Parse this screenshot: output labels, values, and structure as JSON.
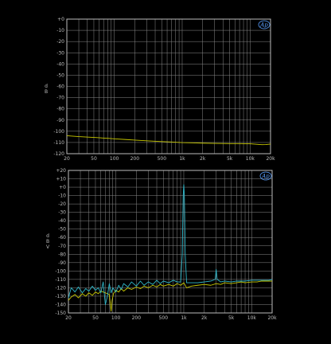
{
  "colors": {
    "background": "#000000",
    "plot_background": "#000000",
    "grid": "#8a8a8a",
    "frame": "#bdbdbd",
    "tick_text": "#bfbfbf",
    "logo": "#5aa0ff"
  },
  "logo_text": "Ap",
  "chart_data": [
    {
      "type": "line",
      "x_scale": "log",
      "xlim": [
        20,
        20000
      ],
      "ylim": [
        -120,
        0
      ],
      "grid": true,
      "y_unit_label": [
        "d",
        "B"
      ],
      "y_ticks": [
        0,
        -10,
        -20,
        -30,
        -40,
        -50,
        -60,
        -70,
        -80,
        -90,
        -100,
        -110,
        -120
      ],
      "y_tick_labels": [
        "+0",
        "-10",
        "-20",
        "-30",
        "-40",
        "-50",
        "-60",
        "-70",
        "-80",
        "-90",
        "-100",
        "-110",
        "-120"
      ],
      "x_ticks": [
        20,
        50,
        100,
        200,
        500,
        1000,
        2000,
        5000,
        10000,
        20000
      ],
      "x_tick_labels": [
        "20",
        "50",
        "100",
        "200",
        "500",
        "1k",
        "2k",
        "5k",
        "10k",
        "20k"
      ],
      "series": [
        {
          "color": "#c8c800",
          "x": [
            20,
            30,
            50,
            80,
            100,
            150,
            200,
            300,
            500,
            700,
            1000,
            1500,
            2000,
            3000,
            5000,
            7000,
            10000,
            13000,
            15000,
            17000,
            20000
          ],
          "y": [
            -104,
            -104.8,
            -105.5,
            -106.3,
            -106.7,
            -107.4,
            -107.9,
            -108.5,
            -109.2,
            -109.6,
            -110.1,
            -110.4,
            -110.6,
            -110.8,
            -111,
            -111,
            -111.2,
            -111.7,
            -112,
            -111.9,
            -111.4
          ]
        }
      ]
    },
    {
      "type": "line",
      "x_scale": "log",
      "xlim": [
        20,
        20000
      ],
      "ylim": [
        -150,
        20
      ],
      "grid": true,
      "y_unit_label": [
        "d",
        "B",
        "V"
      ],
      "y_ticks": [
        20,
        10,
        0,
        -10,
        -20,
        -30,
        -40,
        -50,
        -60,
        -70,
        -80,
        -90,
        -100,
        -110,
        -120,
        -130,
        -140,
        -150
      ],
      "y_tick_labels": [
        "+20",
        "+10",
        "+0",
        "-10",
        "-20",
        "-30",
        "-40",
        "-50",
        "-60",
        "-70",
        "-80",
        "-90",
        "-100",
        "-110",
        "-120",
        "-130",
        "-140",
        "-150"
      ],
      "x_ticks": [
        20,
        50,
        100,
        200,
        500,
        1000,
        2000,
        5000,
        10000,
        20000
      ],
      "x_tick_labels": [
        "20",
        "50",
        "100",
        "200",
        "500",
        "1k",
        "2k",
        "5k",
        "10k",
        "20k"
      ],
      "series": [
        {
          "color": "#c8c800",
          "x": [
            20,
            22,
            25,
            28,
            32,
            36,
            40,
            45,
            50,
            55,
            60,
            70,
            80,
            85,
            88,
            92,
            100,
            110,
            120,
            130,
            150,
            170,
            200,
            230,
            260,
            300,
            350,
            400,
            450,
            500,
            600,
            700,
            800,
            900,
            1000,
            1100,
            1300,
            1600,
            2000,
            2500,
            3000,
            3500,
            4000,
            5000,
            6000,
            7000,
            8000,
            10000,
            12000,
            14000,
            16000,
            18000,
            20000
          ],
          "y": [
            -135,
            -131,
            -128,
            -132,
            -127,
            -130,
            -126,
            -129,
            -125,
            -127,
            -124,
            -126,
            -128,
            -148,
            -135,
            -127,
            -123,
            -125,
            -121,
            -124,
            -120,
            -122,
            -119,
            -121,
            -118,
            -120,
            -117,
            -119,
            -116,
            -118,
            -116,
            -118,
            -115,
            -117,
            -114,
            -120,
            -118,
            -117,
            -116,
            -117,
            -115,
            -116,
            -114,
            -115,
            -114,
            -113,
            -114,
            -113,
            -113,
            -112,
            -112,
            -112,
            -112
          ]
        },
        {
          "color": "#2fb7c9",
          "x": [
            20,
            22,
            25,
            28,
            32,
            36,
            40,
            45,
            50,
            55,
            60,
            65,
            70,
            75,
            80,
            85,
            90,
            100,
            110,
            120,
            130,
            150,
            170,
            200,
            230,
            260,
            300,
            350,
            400,
            450,
            500,
            600,
            700,
            800,
            900,
            950,
            980,
            1000,
            1020,
            1050,
            1100,
            1300,
            1600,
            2000,
            2500,
            2900,
            3000,
            3100,
            3500,
            4000,
            5000,
            6000,
            7000,
            8000,
            10000,
            12000,
            14000,
            16000,
            18000,
            20000
          ],
          "y": [
            -132,
            -120,
            -125,
            -119,
            -126,
            -121,
            -124,
            -118,
            -123,
            -120,
            -126,
            -113,
            -140,
            -130,
            -115,
            -126,
            -120,
            -125,
            -117,
            -122,
            -115,
            -119,
            -113,
            -118,
            -112,
            -117,
            -113,
            -116,
            -111,
            -115,
            -112,
            -114,
            -111,
            -113,
            -113,
            -80,
            -10,
            3,
            -10,
            -80,
            -114,
            -114,
            -114,
            -113,
            -112,
            -110,
            -98,
            -110,
            -113,
            -112,
            -113,
            -112,
            -112,
            -112,
            -111,
            -111,
            -111,
            -111,
            -111,
            -110
          ]
        }
      ]
    }
  ]
}
